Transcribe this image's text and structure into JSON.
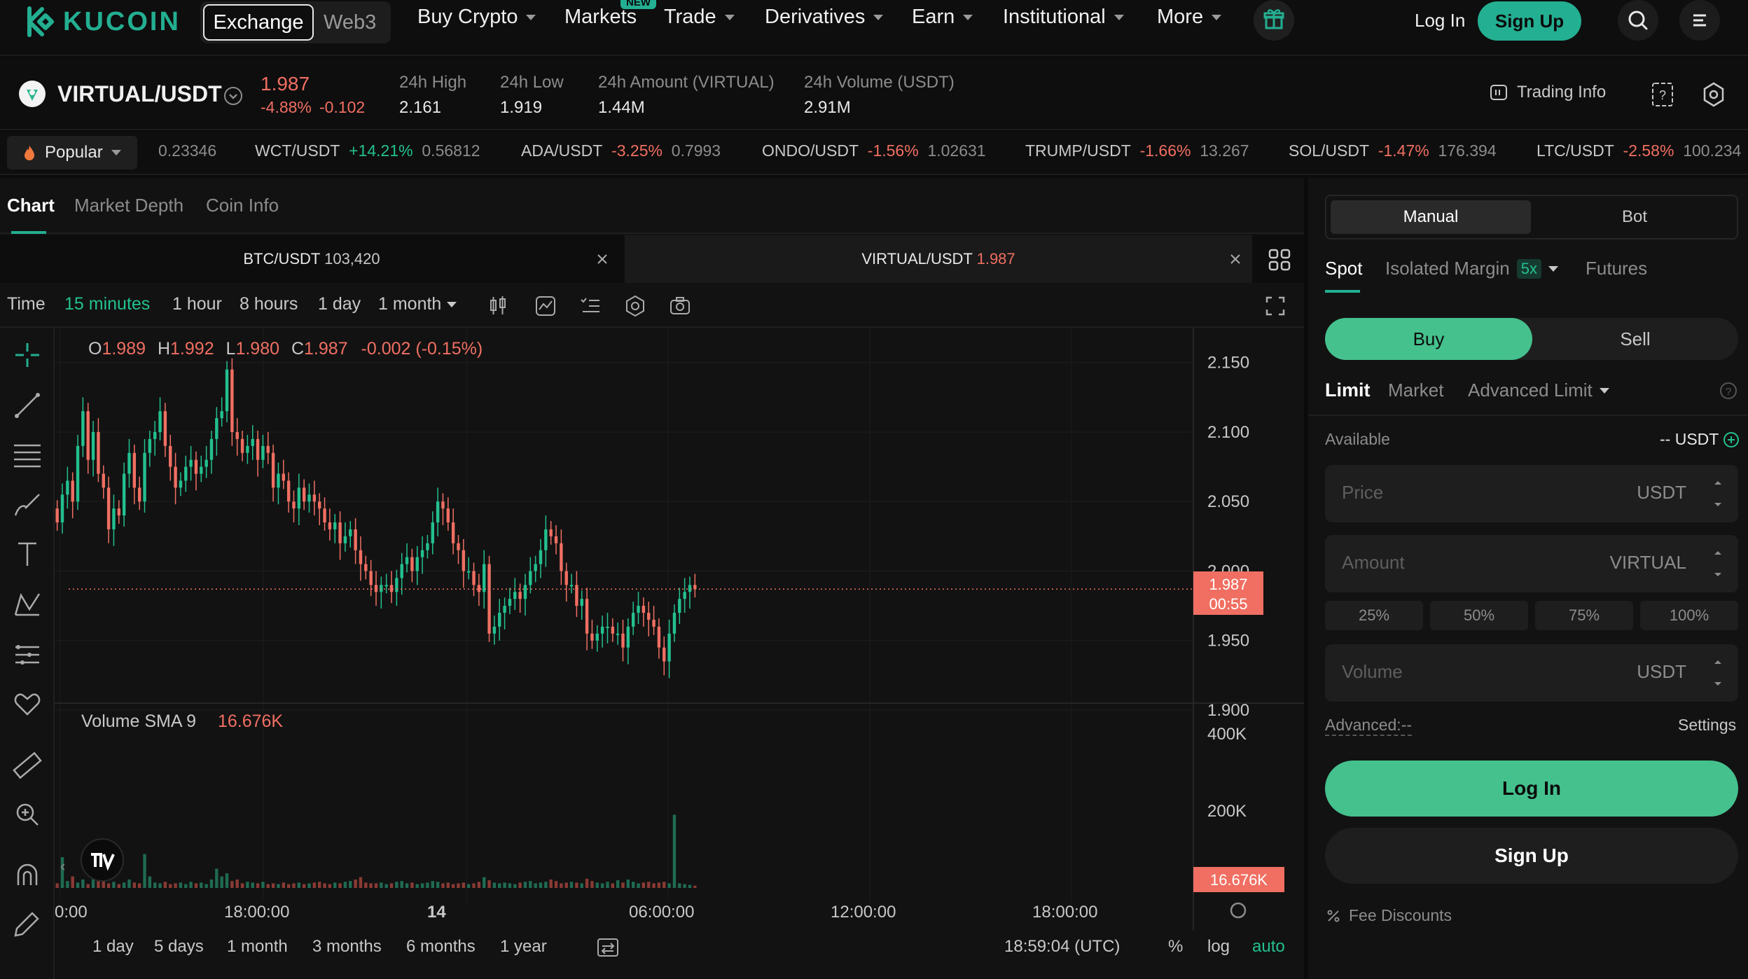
{
  "brand": {
    "name": "KUCOIN"
  },
  "nav": {
    "exchange": "Exchange",
    "web3": "Web3",
    "items": [
      "Buy Crypto",
      "Markets",
      "Trade",
      "Derivatives",
      "Earn",
      "Institutional",
      "More"
    ],
    "new_badge": "NEW",
    "login": "Log In",
    "signup": "Sign Up"
  },
  "ticker": {
    "pair": "VIRTUAL/USDT",
    "price": "1.987",
    "change_pct": "-4.88%",
    "change_abs": "-0.102",
    "high_label": "24h High",
    "high": "2.161",
    "low_label": "24h Low",
    "low": "1.919",
    "amount_label": "24h Amount (VIRTUAL)",
    "amount": "1.44M",
    "volume_label": "24h Volume (USDT)",
    "volume": "2.91M",
    "trading_info": "Trading Info"
  },
  "strip": {
    "popular": "Popular",
    "first_price": "0.23346",
    "markets": [
      {
        "pair": "WCT/USDT",
        "change": "+14.21%",
        "price": "0.56812"
      },
      {
        "pair": "ADA/USDT",
        "change": "-3.25%",
        "price": "0.7993"
      },
      {
        "pair": "ONDO/USDT",
        "change": "-1.56%",
        "price": "1.02631"
      },
      {
        "pair": "TRUMP/USDT",
        "change": "-1.66%",
        "price": "13.267"
      },
      {
        "pair": "SOL/USDT",
        "change": "-1.47%",
        "price": "176.394"
      },
      {
        "pair": "LTC/USDT",
        "change": "-2.58%",
        "price": "100.234"
      }
    ]
  },
  "chart_tabs": [
    "Chart",
    "Market Depth",
    "Coin Info"
  ],
  "pair_tabs": [
    {
      "pair": "BTC/USDT",
      "price": "103,420"
    },
    {
      "pair": "VIRTUAL/USDT",
      "price": "1.987"
    }
  ],
  "timeframes": {
    "label": "Time",
    "items": [
      "15 minutes",
      "1 hour",
      "8 hours",
      "1 day",
      "1 month"
    ]
  },
  "chart": {
    "ohlc": {
      "o": "1.989",
      "h": "1.992",
      "l": "1.980",
      "c": "1.987",
      "chg": "-0.002 (-0.15%)"
    },
    "last_price_tag": "1.987",
    "countdown": "00:55",
    "volume_label": "Volume SMA 9",
    "volume_value": "16.676K",
    "volume_tag": "16.676K",
    "clock": "18:59:04 (UTC)",
    "scale_opts": [
      "%",
      "log",
      "auto"
    ],
    "ranges": [
      "1 day",
      "5 days",
      "1 month",
      "3 months",
      "6 months",
      "1 year"
    ]
  },
  "chart_data": {
    "type": "candlestick",
    "price_axis_ticks": [
      "2.150",
      "2.100",
      "2.050",
      "2.000",
      "1.950",
      "1.900"
    ],
    "volume_axis_ticks": [
      "400K",
      "200K"
    ],
    "time_axis_ticks": [
      "0:00",
      "18:00:00",
      "14",
      "06:00:00",
      "12:00:00",
      "18:00:00"
    ],
    "ylim": [
      1.9,
      2.17
    ],
    "closes": [
      2.035,
      2.055,
      2.065,
      2.05,
      2.09,
      2.115,
      2.08,
      2.1,
      2.07,
      2.06,
      2.03,
      2.045,
      2.04,
      2.07,
      2.085,
      2.06,
      2.05,
      2.085,
      2.095,
      2.1,
      2.115,
      2.09,
      2.075,
      2.06,
      2.065,
      2.075,
      2.08,
      2.07,
      2.075,
      2.08,
      2.095,
      2.11,
      2.115,
      2.145,
      2.1,
      2.095,
      2.085,
      2.09,
      2.095,
      2.08,
      2.09,
      2.085,
      2.06,
      2.07,
      2.065,
      2.05,
      2.045,
      2.06,
      2.05,
      2.055,
      2.05,
      2.045,
      2.035,
      2.03,
      2.035,
      2.02,
      2.025,
      2.03,
      2.015,
      2.005,
      2.0,
      1.99,
      1.985,
      1.99,
      1.99,
      1.985,
      1.995,
      2.005,
      2.01,
      2.0,
      2.01,
      2.015,
      2.02,
      2.035,
      2.05,
      2.045,
      2.035,
      2.02,
      2.015,
      2.0,
      2.0,
      1.99,
      1.985,
      2.005,
      1.955,
      1.96,
      1.97,
      1.975,
      1.98,
      1.985,
      1.98,
      1.99,
      2.0,
      2.005,
      2.015,
      2.03,
      2.025,
      2.02,
      2.0,
      1.99,
      1.99,
      1.975,
      1.98,
      1.955,
      1.95,
      1.955,
      1.96,
      1.96,
      1.955,
      1.955,
      1.945,
      1.96,
      1.97,
      1.975,
      1.97,
      1.965,
      1.96,
      1.945,
      1.935,
      1.955,
      1.97,
      1.98,
      1.985,
      1.99,
      1.987
    ],
    "volumes": [
      12,
      80,
      18,
      30,
      14,
      22,
      10,
      40,
      18,
      22,
      12,
      16,
      10,
      14,
      22,
      14,
      12,
      88,
      30,
      14,
      12,
      16,
      10,
      12,
      14,
      10,
      16,
      12,
      14,
      10,
      22,
      50,
      30,
      38,
      18,
      22,
      12,
      16,
      14,
      12,
      16,
      10,
      12,
      10,
      14,
      10,
      12,
      14,
      10,
      12,
      14,
      16,
      12,
      10,
      14,
      12,
      16,
      18,
      22,
      28,
      14,
      12,
      12,
      14,
      10,
      12,
      16,
      18,
      12,
      14,
      10,
      12,
      14,
      18,
      16,
      12,
      14,
      10,
      12,
      14,
      10,
      12,
      16,
      28,
      20,
      14,
      12,
      14,
      12,
      10,
      14,
      16,
      18,
      12,
      14,
      16,
      22,
      18,
      12,
      14,
      16,
      14,
      12,
      24,
      18,
      14,
      12,
      16,
      12,
      20,
      14,
      22,
      16,
      12,
      14,
      16,
      12,
      14,
      16,
      12,
      190,
      12,
      10,
      8,
      6
    ]
  },
  "trade": {
    "modes": [
      "Manual",
      "Bot"
    ],
    "types": [
      "Spot",
      "Isolated Margin",
      "Futures"
    ],
    "leverage": "5x",
    "buy": "Buy",
    "sell": "Sell",
    "orders": [
      "Limit",
      "Market",
      "Advanced Limit"
    ],
    "available_label": "Available",
    "available_value": "-- USDT",
    "price_ph": "Price",
    "price_unit": "USDT",
    "amount_ph": "Amount",
    "amount_unit": "VIRTUAL",
    "percents": [
      "25%",
      "50%",
      "75%",
      "100%"
    ],
    "volume_ph": "Volume",
    "volume_unit": "USDT",
    "advanced": "Advanced:--",
    "settings": "Settings",
    "login": "Log In",
    "signup": "Sign Up",
    "fee": "Fee Discounts"
  },
  "colors": {
    "accent": "#23af91",
    "up": "#23c08f",
    "down": "#f06f62",
    "tag": "#f06f62"
  }
}
